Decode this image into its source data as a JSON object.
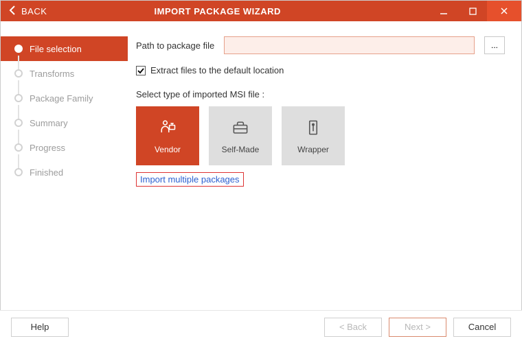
{
  "titlebar": {
    "back_label": "BACK",
    "title": "IMPORT PACKAGE WIZARD"
  },
  "sidebar": {
    "steps": [
      {
        "label": "File selection",
        "active": true
      },
      {
        "label": "Transforms",
        "active": false
      },
      {
        "label": "Package Family",
        "active": false
      },
      {
        "label": "Summary",
        "active": false
      },
      {
        "label": "Progress",
        "active": false
      },
      {
        "label": "Finished",
        "active": false
      }
    ]
  },
  "form": {
    "path_label": "Path to package file",
    "path_value": "",
    "browse_label": "...",
    "extract_checked": true,
    "extract_label": "Extract files to the default location",
    "select_type_label": "Select type of imported MSI file :",
    "tiles": [
      {
        "label": "Vendor",
        "selected": true,
        "icon": "vendor"
      },
      {
        "label": "Self-Made",
        "selected": false,
        "icon": "toolbox"
      },
      {
        "label": "Wrapper",
        "selected": false,
        "icon": "wrapper"
      }
    ],
    "import_link": "Import multiple packages"
  },
  "footer": {
    "help": "Help",
    "back": "< Back",
    "next": "Next >",
    "cancel": "Cancel"
  },
  "colors": {
    "accent": "#d04525",
    "close": "#e6502c",
    "input_border": "#e6a08a",
    "input_bg": "#fdeee9"
  }
}
